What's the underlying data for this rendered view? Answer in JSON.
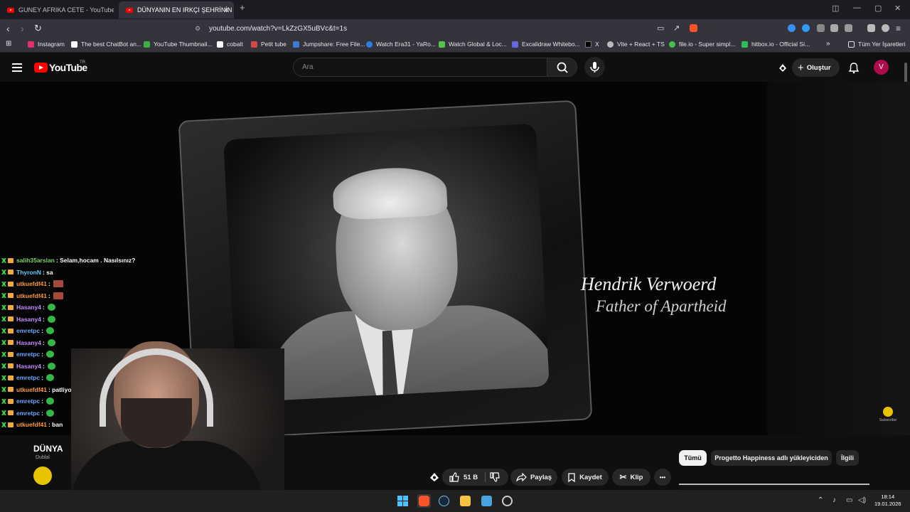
{
  "browser": {
    "tabs": [
      {
        "title": "GUNEY AFRIKA CETE - YouTube"
      },
      {
        "title": "DÜNYANIN EN IRKÇI ŞEHRİNİN"
      }
    ],
    "new_tab": "+",
    "url": "youtube.com/watch?v=LkZzGX5uBVc&t=1s",
    "bookmarks": [
      {
        "label": "Instagram",
        "color": "#e1306c"
      },
      {
        "label": "The best ChatBot an...",
        "color": "#ffffff"
      },
      {
        "label": "YouTube Thumbnail...",
        "color": "#3cb043"
      },
      {
        "label": "cobalt",
        "color": "#ffffff"
      },
      {
        "label": "Petit tube",
        "color": "#d04848"
      },
      {
        "label": "Jumpshare: Free File...",
        "color": "#3a7bd5"
      },
      {
        "label": "Watch Era31 - YaRo...",
        "color": "#2f7de1"
      },
      {
        "label": "Watch Global & Loc...",
        "color": "#53c34b"
      },
      {
        "label": "Excalidraw Whitebo...",
        "color": "#6965db"
      },
      {
        "label": "X",
        "color": "#000000"
      },
      {
        "label": "Vite + React + TS",
        "color": "#bbbbbb"
      },
      {
        "label": "file.io - Super simpl...",
        "color": "#44c24a"
      },
      {
        "label": "hitbox.io - Official Si...",
        "color": "#2ebd5a"
      }
    ],
    "all_bookmarks": "Tüm Yer İşaretleri"
  },
  "youtube": {
    "logo_text": "YouTube",
    "country_code": "TR",
    "search_placeholder": "Ara",
    "create_label": "Oluştur",
    "avatar_letter": "V",
    "video_caption_name": "Hendrik Verwoerd",
    "video_caption_role": "Father of Apartheid",
    "watermark_label": "Subscribe",
    "title_partial": "DÜNYA",
    "channel_partial": "Dublal",
    "actions": {
      "likes": "51 B",
      "share": "Paylaş",
      "save": "Kaydet",
      "clip": "Klip",
      "more": "•••"
    },
    "chips": [
      {
        "label": "Tümü",
        "selected": true
      },
      {
        "label": "Progetto Happiness adlı yükleyiciden",
        "selected": false
      },
      {
        "label": "İlgili",
        "selected": false
      }
    ]
  },
  "chat": [
    {
      "user": "salih35arslan",
      "color": "#7fd46a",
      "message": ": Selam,hocam . Nasılsınız?",
      "emote": ""
    },
    {
      "user": "ThyronN",
      "color": "#5fd0ff",
      "message": ": sa",
      "emote": ""
    },
    {
      "user": "utkuefdf41",
      "color": "#ff9a3c",
      "message": " :",
      "emote": "box"
    },
    {
      "user": "utkuefdf41",
      "color": "#ff9a3c",
      "message": " :",
      "emote": "box"
    },
    {
      "user": "Hasany4",
      "color": "#c58cff",
      "message": " :",
      "emote": "round"
    },
    {
      "user": "Hasany4",
      "color": "#c58cff",
      "message": " :",
      "emote": "round"
    },
    {
      "user": "emretpc",
      "color": "#6aa8ff",
      "message": " :",
      "emote": "round"
    },
    {
      "user": "Hasany4",
      "color": "#c58cff",
      "message": " :",
      "emote": "round"
    },
    {
      "user": "emretpc",
      "color": "#6aa8ff",
      "message": " :",
      "emote": "round"
    },
    {
      "user": "Hasany4",
      "color": "#c58cff",
      "message": " :",
      "emote": "round"
    },
    {
      "user": "emretpc",
      "color": "#6aa8ff",
      "message": " :",
      "emote": "round"
    },
    {
      "user": "utkuefdf41",
      "color": "#ff9a3c",
      "message": " : patliyordu",
      "emote": ""
    },
    {
      "user": "emretpc",
      "color": "#6aa8ff",
      "message": " :",
      "emote": "round"
    },
    {
      "user": "emretpc",
      "color": "#6aa8ff",
      "message": " :",
      "emote": "round"
    },
    {
      "user": "utkuefdf41",
      "color": "#ff9a3c",
      "message": " : ban",
      "emote": ""
    }
  ],
  "taskbar": {
    "time": "18:14",
    "date": "19.01.2026"
  }
}
